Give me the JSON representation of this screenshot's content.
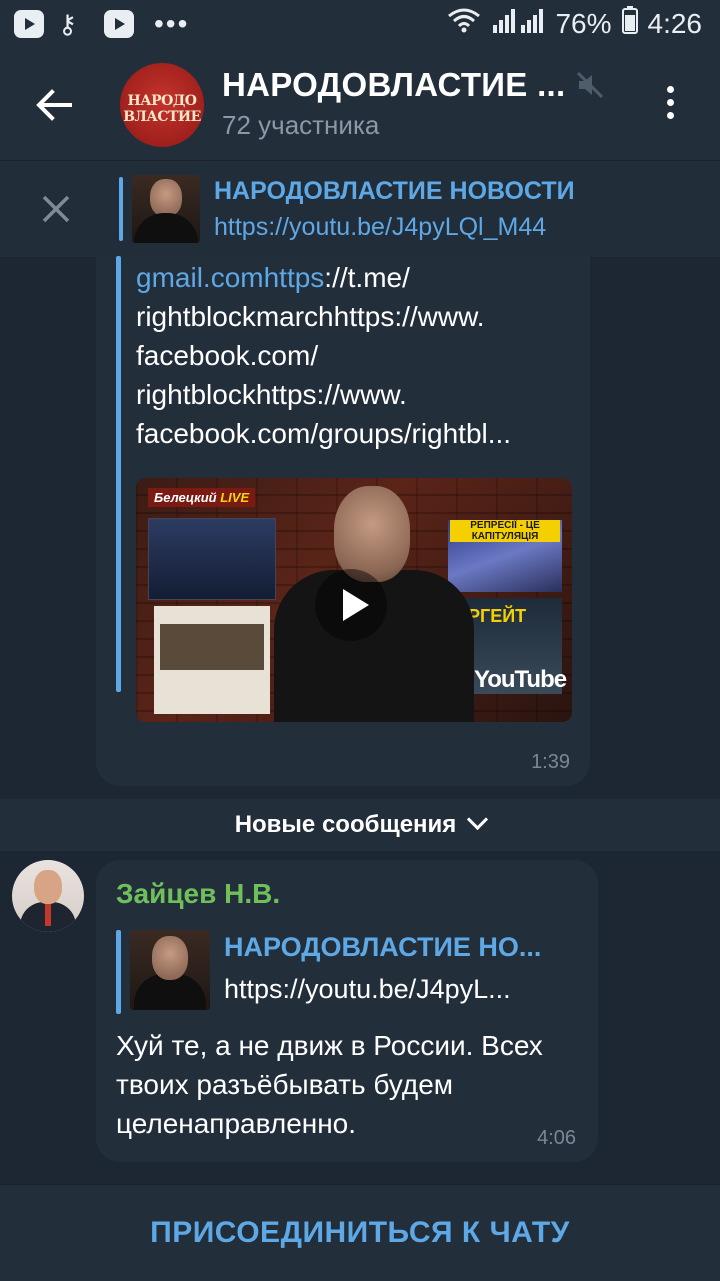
{
  "status_bar": {
    "battery": "76%",
    "time": "4:26"
  },
  "header": {
    "title": "НАРОДОВЛАСТИЕ ...",
    "subtitle": "72 участника",
    "avatar_text_line1": "НАРОДО",
    "avatar_text_line2": "ВЛАСТИЕ"
  },
  "pinned": {
    "title": "НАРОДОВЛАСТИЕ НОВОСТИ",
    "text": "https://youtu.be/J4pyLQl_M44"
  },
  "message1": {
    "line1_link": "gmail.comhttps",
    "line1_rest": "://t.me/",
    "line2": "rightblockmarchhttps://www.",
    "line3": "facebook.com/",
    "line4": "rightblockhttps://www.",
    "line5": "facebook.com/groups/rightbl...",
    "video_logo": "Белецкий",
    "video_logo_live": "LIVE",
    "video_panel_caption": "РЕПРЕСІЇ - ЦЕ КАПІТУЛЯЦІЯ",
    "video_panel_caption2": "ЕРГЕЙТ",
    "video_brand": "YouTube",
    "time": "1:39"
  },
  "divider": {
    "label": "Новые сообщения"
  },
  "message2": {
    "sender": "Зайцев Н.В.",
    "reply_title": "НАРОДОВЛАСТИЕ НО...",
    "reply_url": "https://youtu.be/J4pyL...",
    "text": "Хуй те, а не движ в России. Всех твоих разъёбывать будем целенаправленно.",
    "time": "4:06"
  },
  "join": {
    "label": "ПРИСОЕДИНИТЬСЯ К ЧАТУ"
  },
  "colors": {
    "background": "#1d2733",
    "bubble": "#232e3b",
    "accent_link": "#5ea8e6",
    "sender_name": "#6fc05a"
  }
}
